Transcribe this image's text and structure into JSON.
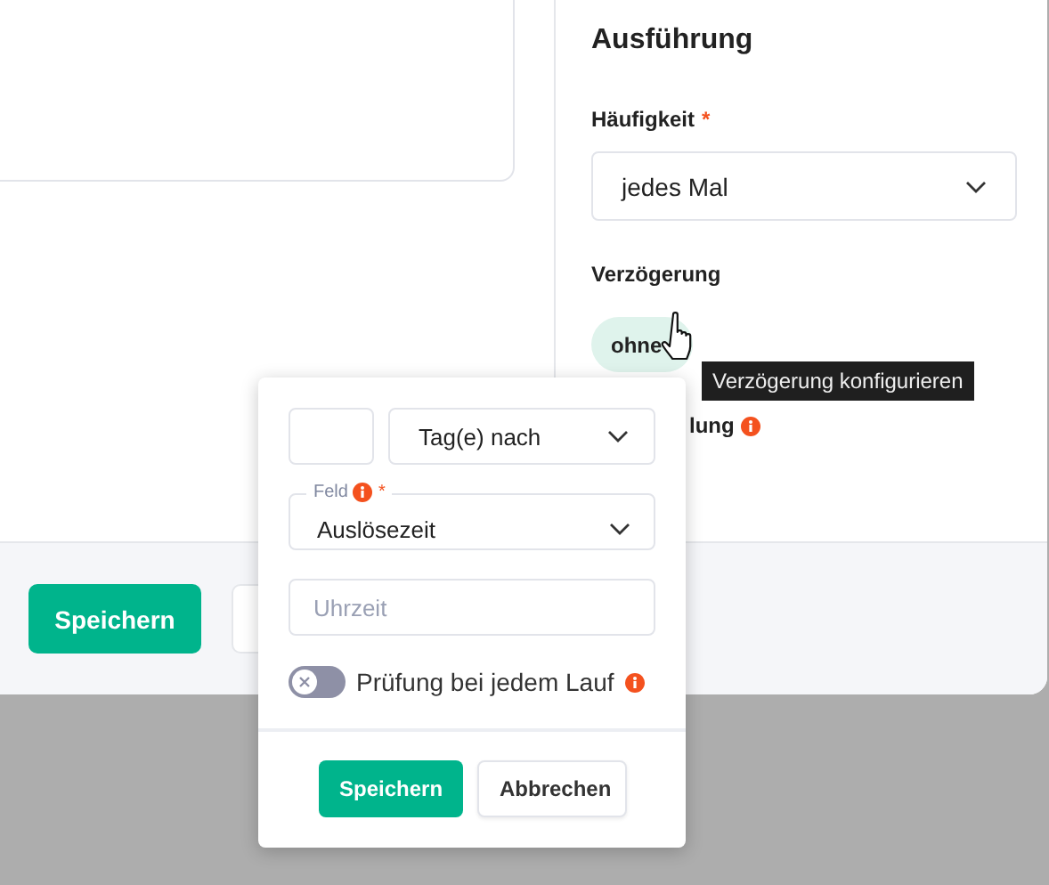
{
  "section_title": "Ausführung",
  "frequency": {
    "label": "Häufigkeit",
    "required_mark": "*",
    "value": "jedes Mal"
  },
  "delay": {
    "label": "Verzögerung",
    "chip": "ohne"
  },
  "partial_label": {
    "text": "lung",
    "info": true
  },
  "tooltip": "Verzögerung konfigurieren",
  "footer": {
    "save_button": "Speichern"
  },
  "popover": {
    "unit_select": "Tag(e) nach",
    "field_select": {
      "label": "Feld",
      "info": true,
      "required_mark": "*",
      "value": "Auslösezeit"
    },
    "time_input": {
      "placeholder": "Uhrzeit"
    },
    "toggle": {
      "label": "Prüfung bei jedem Lauf",
      "on": false,
      "info": true
    },
    "buttons": [
      {
        "label": "Speichern",
        "kind": "primary"
      },
      {
        "label": "Abbrechen",
        "kind": "secondary"
      }
    ]
  }
}
